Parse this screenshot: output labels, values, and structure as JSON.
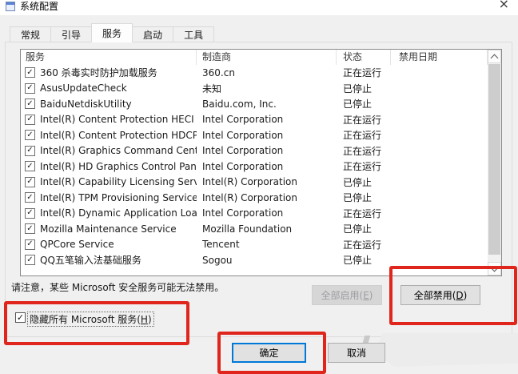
{
  "window": {
    "title": "系统配置",
    "close_glyph": "×"
  },
  "tabs": [
    {
      "id": "general",
      "label": "常规",
      "active": false
    },
    {
      "id": "boot",
      "label": "引导",
      "active": false
    },
    {
      "id": "services",
      "label": "服务",
      "active": true
    },
    {
      "id": "startup",
      "label": "启动",
      "active": false
    },
    {
      "id": "tools",
      "label": "工具",
      "active": false
    }
  ],
  "table": {
    "headers": {
      "service": "服务",
      "vendor": "制造商",
      "status": "状态",
      "date": "禁用日期"
    },
    "rows": [
      {
        "checked": true,
        "service": "360 杀毒实时防护加载服务",
        "vendor": "360.cn",
        "status": "正在运行",
        "date": ""
      },
      {
        "checked": true,
        "service": "AsusUpdateCheck",
        "vendor": "未知",
        "status": "已停止",
        "date": ""
      },
      {
        "checked": true,
        "service": "BaiduNetdiskUtility",
        "vendor": "Baidu.com, Inc.",
        "status": "已停止",
        "date": ""
      },
      {
        "checked": true,
        "service": "Intel(R) Content Protection HECI ...",
        "vendor": "Intel Corporation",
        "status": "正在运行",
        "date": ""
      },
      {
        "checked": true,
        "service": "Intel(R) Content Protection HDCP...",
        "vendor": "Intel Corporation",
        "status": "正在运行",
        "date": ""
      },
      {
        "checked": true,
        "service": "Intel(R) Graphics Command Cent...",
        "vendor": "Intel Corporation",
        "status": "正在运行",
        "date": ""
      },
      {
        "checked": true,
        "service": "Intel(R) HD Graphics Control Pan...",
        "vendor": "Intel Corporation",
        "status": "正在运行",
        "date": ""
      },
      {
        "checked": true,
        "service": "Intel(R) Capability Licensing Servi...",
        "vendor": "Intel(R) Corporation",
        "status": "已停止",
        "date": ""
      },
      {
        "checked": true,
        "service": "Intel(R) TPM Provisioning Service",
        "vendor": "Intel(R) Corporation",
        "status": "已停止",
        "date": ""
      },
      {
        "checked": true,
        "service": "Intel(R) Dynamic Application Loa...",
        "vendor": "Intel Corporation",
        "status": "正在运行",
        "date": ""
      },
      {
        "checked": true,
        "service": "Mozilla Maintenance Service",
        "vendor": "Mozilla Foundation",
        "status": "已停止",
        "date": ""
      },
      {
        "checked": true,
        "service": "QPCore Service",
        "vendor": "Tencent",
        "status": "正在运行",
        "date": ""
      },
      {
        "checked": true,
        "service": "QQ五笔输入法基础服务",
        "vendor": "Sogou",
        "status": "已停止",
        "date": ""
      }
    ]
  },
  "note": "请注意，某些 Microsoft 安全服务可能无法禁用。",
  "buttons": {
    "enable_all": {
      "pre": "全部启用(",
      "mnemonic": "E",
      "post": ")",
      "enabled": false
    },
    "disable_all": {
      "pre": "全部禁用(",
      "mnemonic": "D",
      "post": ")",
      "enabled": true
    },
    "ok": "确定",
    "cancel": "取消"
  },
  "hide_ms_checkbox": {
    "pre": "隐藏所有 Microsoft 服务(",
    "mnemonic": "H",
    "post": ")",
    "checked": true
  },
  "colors": {
    "accent": "#0078d7",
    "highlight_red": "#e0261c"
  }
}
